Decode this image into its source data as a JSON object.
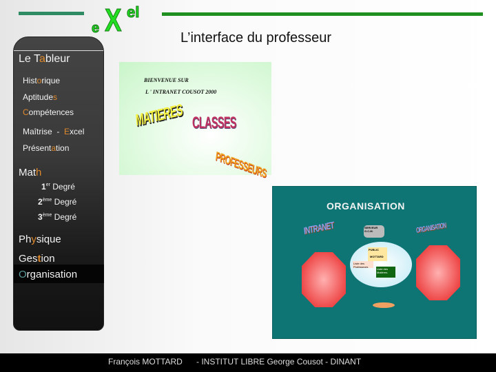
{
  "header": {
    "logo": {
      "e": "e",
      "x": "X",
      "el": "el"
    },
    "title": "L’interface du professeur",
    "accent": "#1f8f1f"
  },
  "sidebar": {
    "section1": {
      "parts": [
        "Le  T",
        "a",
        "bleur"
      ]
    },
    "items1": [
      {
        "parts": [
          "Hist",
          "o",
          "rique"
        ]
      },
      {
        "parts": [
          "Aptitude",
          "s",
          ""
        ]
      },
      {
        "parts": [
          "",
          "C",
          "ompétences"
        ]
      },
      {
        "parts": [
          "Maîtrise  -  ",
          "E",
          "xcel"
        ]
      },
      {
        "parts": [
          "Présent",
          "a",
          "tion"
        ]
      }
    ],
    "math": {
      "parts": [
        "Mat",
        "h",
        ""
      ]
    },
    "degrees": [
      {
        "num": "1",
        "sup": "er",
        "label": " Degré"
      },
      {
        "num": "2",
        "sup": "ème",
        "label": " Degré"
      },
      {
        "num": "3",
        "sup": "ème",
        "label": " Degré"
      }
    ],
    "physique": {
      "parts": [
        "Ph",
        "y",
        "sique"
      ]
    },
    "gestion": {
      "parts": [
        "Ges",
        "t",
        "ion"
      ]
    },
    "organisation": {
      "parts": [
        "",
        "O",
        "rganisation"
      ],
      "selected": true
    },
    "highlight_color": "#e08a2c"
  },
  "slide1": {
    "line1": "BIENVENUE SUR",
    "line2": "L ' INTRANET COUSOT 2000",
    "words": [
      "MATIERES",
      "CLASSES",
      "PROFESSEURS"
    ]
  },
  "slide2": {
    "title": "ORGANISATION",
    "left_label": "INTRANET",
    "right_label": "ORGANISATION",
    "server": "SERVEUR G.C.M.",
    "center": [
      "PUBLIC",
      "MOTTARD",
      "Liste des Professeurs",
      "Liste des Matières"
    ],
    "bg": "#0f7474"
  },
  "footer": {
    "author": "François MOTTARD",
    "institution": "- INSTITUT LIBRE George Cousot - DINANT"
  }
}
